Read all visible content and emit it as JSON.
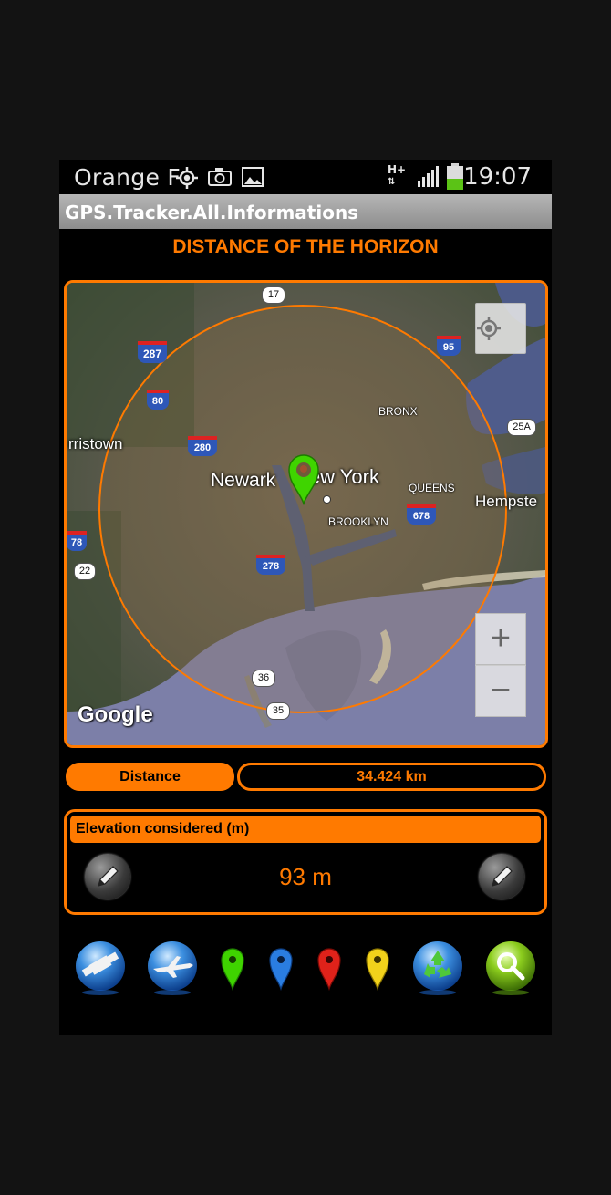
{
  "status_bar": {
    "carrier": "Orange F",
    "network_type": "H+",
    "time": "19:07",
    "icons": [
      "gps-icon",
      "camera-icon",
      "gallery-icon",
      "signal-icon",
      "battery-icon"
    ],
    "battery_level": 0.35
  },
  "app": {
    "title": "GPS.Tracker.All.Informations"
  },
  "page": {
    "heading": "DISTANCE OF THE HORIZON"
  },
  "map": {
    "labels": {
      "city_newark": "Newark",
      "city_new_york": "New York",
      "city_morristown": "rristown",
      "city_hempstead": "Hempste",
      "area_bronx": "BRONX",
      "area_queens": "QUEENS",
      "area_brooklyn": "BROOKLYN",
      "attribution": "Google"
    },
    "shields": {
      "r17": "17",
      "i287": "287",
      "i95": "95",
      "i80": "80",
      "r25a": "25A",
      "i280": "280",
      "i678": "678",
      "i78": "78",
      "r22": "22",
      "i278": "278",
      "r36": "36",
      "r35": "35"
    },
    "controls": {
      "zoom_in": "+",
      "zoom_out": "−"
    },
    "colors": {
      "horizon_circle": "#ff7a00",
      "marker": "#3fd400"
    }
  },
  "distance": {
    "label": "Distance",
    "value": "34.424 km"
  },
  "elevation": {
    "label": "Elevation considered (m)",
    "value": "93 m"
  },
  "toolbar": {
    "buttons": [
      "satellite-icon",
      "airplane-icon",
      "green-marker-icon",
      "blue-marker-icon",
      "red-marker-icon",
      "yellow-marker-icon",
      "recycle-icon",
      "search-icon"
    ]
  },
  "colors": {
    "accent": "#ff7a00",
    "background": "#000000"
  }
}
